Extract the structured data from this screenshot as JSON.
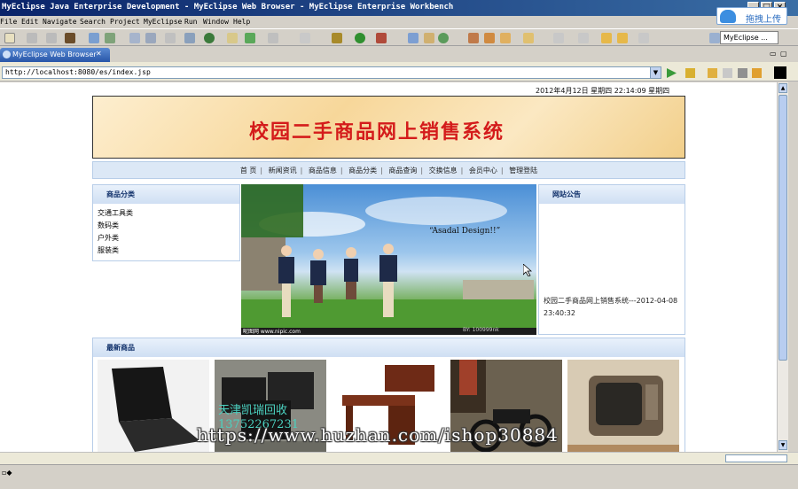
{
  "window": {
    "title": "MyEclipse Java Enterprise Development - MyEclipse Web Browser - MyEclipse Enterprise Workbench"
  },
  "menu": [
    "File",
    "Edit",
    "Navigate",
    "Search",
    "Project",
    "MyEclipse",
    "Run",
    "Window",
    "Help"
  ],
  "upload_widget": {
    "label": "拖拽上传"
  },
  "toolbar": {
    "perspective_label": "MyEclipse ..."
  },
  "editor_tab": {
    "label": "MyEclipse Web Browser",
    "close_glyph": "✕"
  },
  "browser": {
    "url": "http://localhost:8080/es/index.jsp"
  },
  "page": {
    "datetime": "2012年4月12日 星期四 22:14:09  星期四",
    "banner_title": "校园二手商品网上销售系统",
    "nav": [
      "首 页",
      "新闻资讯",
      "商品信息",
      "商品分类",
      "商品查询",
      "交换信息",
      "会员中心",
      "管理登陆"
    ],
    "category_panel": {
      "title": "商品分类",
      "items": [
        "交通工具类",
        "数码类",
        "户外类",
        "服装类"
      ]
    },
    "hero": {
      "caption": "“Asadal Design!!”",
      "footer_left": "昵图网 www.nipic.com",
      "footer_right": "BY: 100999nk"
    },
    "notice_panel": {
      "title": "网站公告",
      "entry": "校园二手商品网上销售系统---2012-04-08 23:40:32"
    },
    "new_goods": {
      "title": "最新商品",
      "products": [
        "laptop",
        "computer-monitors",
        "office-desk",
        "motorcycle",
        "vintage-tv"
      ],
      "overlay_text": "天津凯瑞回收 13752267231"
    },
    "watermark": "https://www.huzhan.com/ishop30884"
  }
}
